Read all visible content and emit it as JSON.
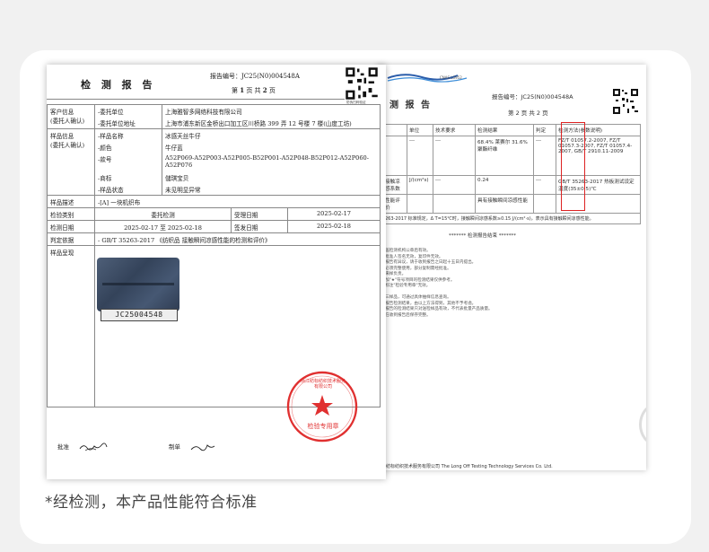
{
  "back_doc": {
    "logo_text": "CNAS L5952",
    "title": "测 报 告",
    "report_no": "报告编号：JC25(N0)004548A",
    "page_no": "第 2 页 共 2 页",
    "headers": [
      "",
      "单位",
      "技术要求",
      "检测结果",
      "判定",
      "检测方法(参数说明)"
    ],
    "rows": [
      [
        "",
        "---",
        "---",
        "68.4% 莱赛尔 31.6% 聚酯纤维",
        "---",
        "FZ/T 01057.2-2007, FZ/T 01057.3-2007, FZ/T 01057.4-2007, GB/T 2910.11-2009"
      ],
      [
        "接触凉感系数",
        "J/(cm²s)",
        "---",
        "0.24",
        "---",
        "GB/T 35263-2017 热板测试设定温度(35±0.5)℃"
      ],
      [
        "性能评价",
        "",
        "",
        "具有接触瞬间凉感性能",
        "",
        ""
      ]
    ],
    "note": "263-2017 标准规定，Δ T=15℃时，接触瞬间凉感系数≥0.15 J/(cm²·s)，表示具有接触瞬间凉感性能。",
    "end_text": "******* 检测报告结束 *******",
    "notes": [
      "告在盖检测机构公章后有效。",
      "告无批准人签名无效，复印件无效。",
      "对本报告有异议，请于收到报告之日起十五日内提出。",
      "报告必须完整使用，部分复制需经批准。",
      "仅对来样负责。",
      "告中加\"★\"符号项目的检测结果仅供参考。",
      "告中标注\"检验专用章\"无效。",
      "",
      "一二三样品，可通过具体抽样信息查询。",
      "。本报告检测结果，由以上方法得到，其他不予考虑。",
      "。本报告的检测结果只对送检样品有效，不代表批量产品质量。",
      "。请在收到报告后保存完整。"
    ],
    "footer": "浙江纺标纺织技术服务有限公司  The Long Off Testing Technology Services Co. Ltd."
  },
  "front_doc": {
    "title": "检 测 报 告",
    "report_no": "报告编号：JC25(N0)004548A",
    "page_no_pre": "第 ",
    "page_cur": "1",
    "page_mid": " 页 共 ",
    "page_total": "2",
    "page_post": " 页",
    "qr_caption": "防伪扫码验证",
    "client_label": [
      "客户信息",
      "(委托人确认)"
    ],
    "client_rows": [
      {
        "k": "-委托单位",
        "v": "上海雅智多网络科技有限公司"
      },
      {
        "k": "-委托单位地址",
        "v": "上海市浦东新区金桥出口加工区川桥路 399 弄 12 号楼 7 楼(山度工坊)"
      }
    ],
    "sample_label": [
      "样品信息",
      "(委托人确认)"
    ],
    "sample_rows": [
      {
        "k": "-样品名称",
        "v": "冰感天丝牛仔"
      },
      {
        "k": "-颜色",
        "v": "牛仔蓝"
      },
      {
        "k": "-款号",
        "v": "A52P069-A52P003-A52P005-B52P001-A52P048-B52P012-A52P060-A52P076"
      },
      {
        "k": "-商标",
        "v": "儲琪宝贝"
      },
      {
        "k": "-样品状态",
        "v": "未见明显异常"
      }
    ],
    "desc_label": "样品描述",
    "desc_value": "-[A] 一块机织布",
    "type_label": "检验类别",
    "type_value": "委托检测",
    "recv_label": "受理日期",
    "recv_value": "2025-02-17",
    "date_label": "检测日期",
    "date_value": "2025-02-17 至 2025-02-18",
    "issue_label": "签发日期",
    "issue_value": "2025-02-18",
    "basis_label": "判定依据",
    "basis_value": "- GB/T 35263-2017 《纺织品 接触瞬间凉感性能的检测和评价》",
    "photo_label": "样品呈现",
    "tag_text": "JC25004548",
    "stamp_text": "检验专用章",
    "stamp_ring": "浙江纺标纺织技术服务有限公司",
    "approve_label": "批准",
    "maker_label": "制单"
  },
  "caption": "*经检测，本产品性能符合标准",
  "colors": {
    "stamp": "#e03030",
    "highlight": "#d22222",
    "caption": "#444444"
  }
}
